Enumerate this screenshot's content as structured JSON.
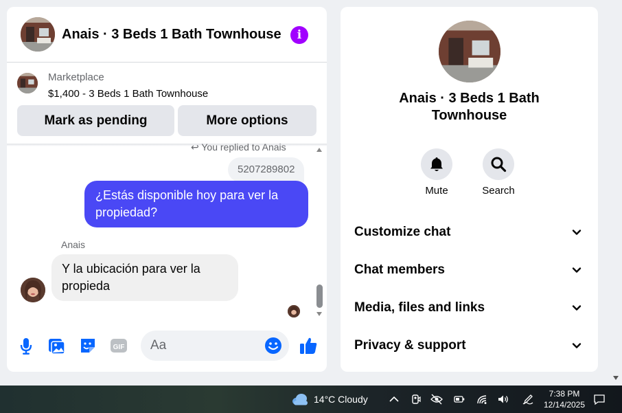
{
  "chat": {
    "title": "Anais · 3 Beds 1 Bath Townhouse",
    "marketplace_label": "Marketplace",
    "listing": "$1,400 - 3 Beds 1 Bath Townhouse",
    "mark_pending_label": "Mark as pending",
    "more_options_label": "More options",
    "replied_to": "You replied to Anais",
    "quoted_text": "5207289802",
    "outgoing_message": "¿Estás disponible hoy para ver la propiedad?",
    "sender_name": "Anais",
    "incoming_message": "Y la ubicación para ver la propieda",
    "input_placeholder": "Aa"
  },
  "info_panel": {
    "name": "Anais · 3 Beds 1 Bath Townhouse",
    "mute_label": "Mute",
    "search_label": "Search",
    "sections": [
      {
        "label": "Customize chat"
      },
      {
        "label": "Chat members"
      },
      {
        "label": "Media, files and links"
      },
      {
        "label": "Privacy & support"
      }
    ]
  },
  "taskbar": {
    "weather": "14°C  Cloudy",
    "time": "7:38 PM",
    "date": "12/14/2025"
  },
  "colors": {
    "accent": "#0866ff",
    "outgoing_bubble": "#4a48f5",
    "info_icon": "#a100ff"
  },
  "icons": [
    "house-avatar",
    "info-icon",
    "microphone-icon",
    "photo-icon",
    "sticker-icon",
    "gif-icon",
    "emoji-icon",
    "thumbs-up-icon",
    "bell-icon",
    "search-icon",
    "chevron-down-icon"
  ]
}
